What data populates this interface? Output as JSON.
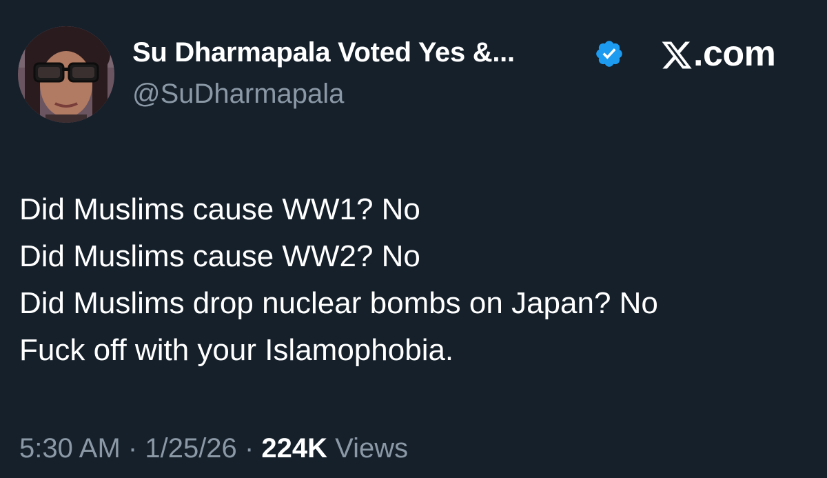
{
  "tweet": {
    "display_name": "Su Dharmapala Voted Yes &...",
    "handle": "@SuDharmapala",
    "verified_icon": "verified-badge-icon",
    "brand": {
      "logo_icon": "x-logo-icon",
      "suffix": ".com"
    },
    "text_lines": [
      "Did Muslims cause WW1? No",
      "Did Muslims cause WW2? No",
      "Did Muslims drop nuclear bombs on Japan? No",
      "Fuck off with your Islamophobia."
    ],
    "time": "5:30 AM",
    "date": "1/25/26",
    "separator": "·",
    "views_count": "224K",
    "views_label": "Views"
  },
  "colors": {
    "background": "#15202b",
    "primary_text": "#ffffff",
    "secondary_text": "#8b98a5",
    "verified_blue": "#1d9bf0"
  }
}
